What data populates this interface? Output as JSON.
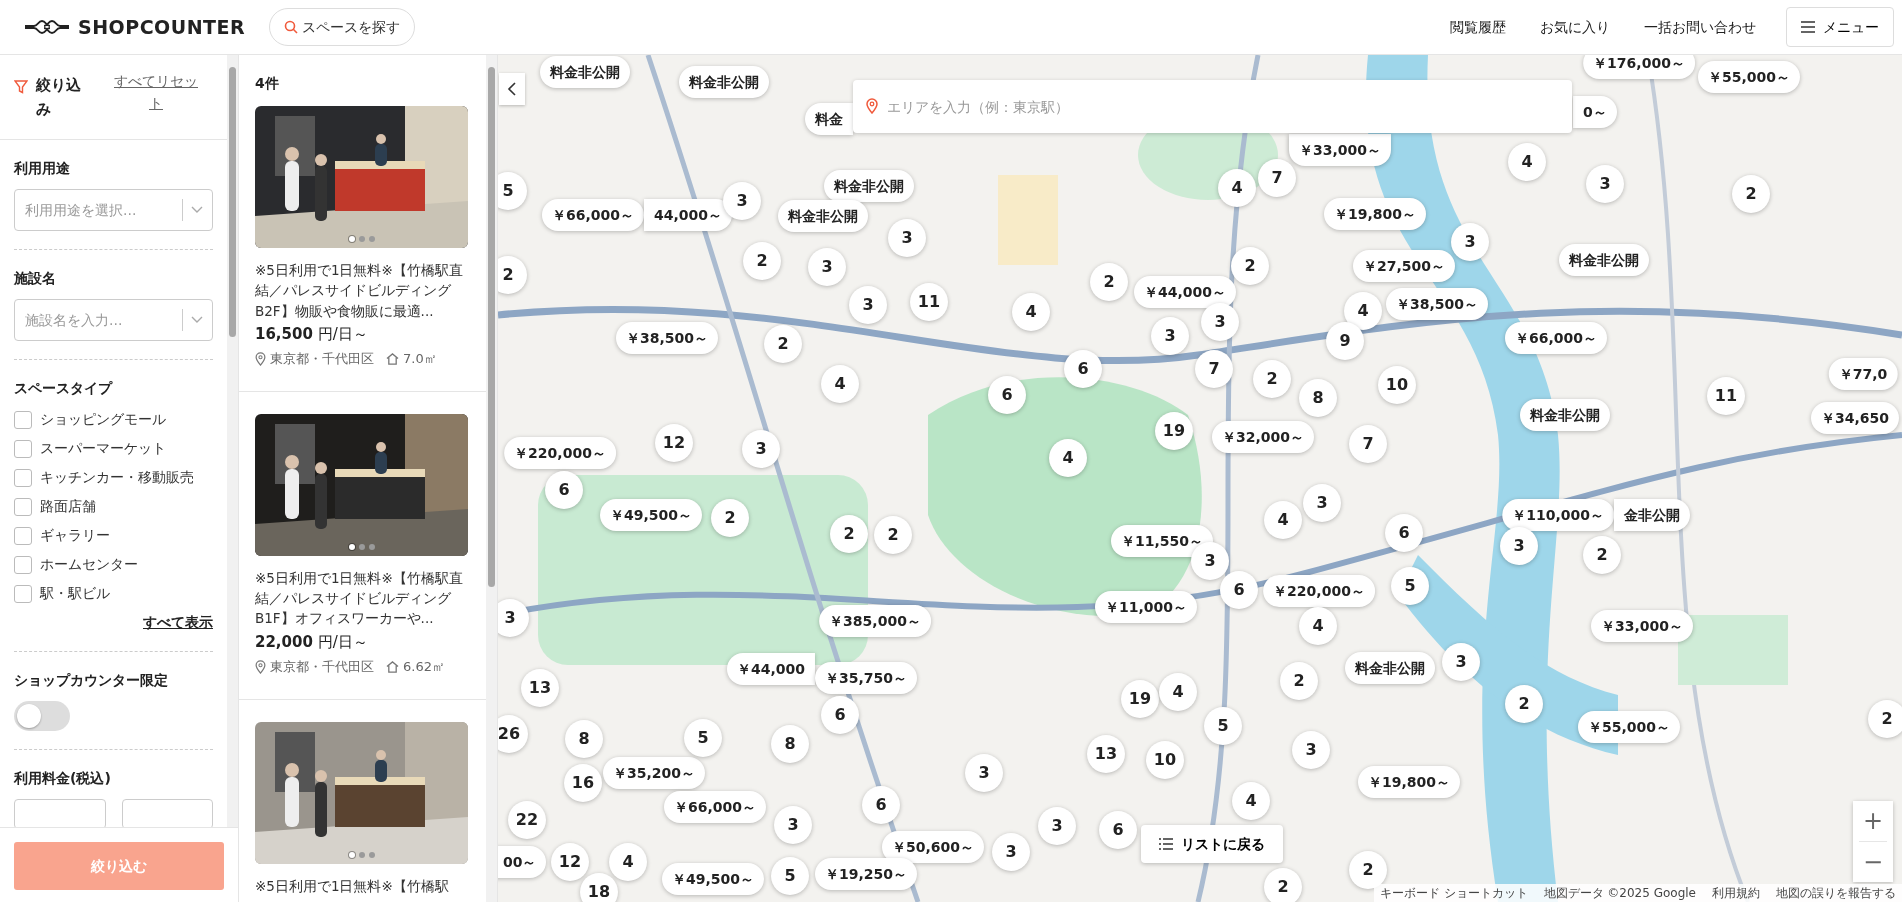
{
  "header": {
    "logo": "SHOPCOUNTER",
    "search_button": "スペースを探す",
    "nav": [
      "閲覧履歴",
      "お気に入り",
      "一括お問い合わせ"
    ],
    "menu_button": "メニュー"
  },
  "filters": {
    "title": "絞り込み",
    "reset": "すべてリセット",
    "apply_button": "絞り込む",
    "sections": [
      {
        "kind": "select",
        "label": "利用用途",
        "placeholder": "利用用途を選択..."
      },
      {
        "kind": "select",
        "label": "施設名",
        "placeholder": "施設名を入力..."
      },
      {
        "kind": "checklist",
        "label": "スペースタイプ",
        "more": "すべて表示",
        "options": [
          {
            "label": "ショッピングモール",
            "checked": false
          },
          {
            "label": "スーパーマーケット",
            "checked": false
          },
          {
            "label": "キッチンカー・移動販売",
            "checked": false
          },
          {
            "label": "路面店舗",
            "checked": false
          },
          {
            "label": "ギャラリー",
            "checked": false
          },
          {
            "label": "ホームセンター",
            "checked": false
          },
          {
            "label": "駅・駅ビル",
            "checked": false
          }
        ]
      },
      {
        "kind": "toggle",
        "label": "ショップカウンター限定",
        "on": false
      },
      {
        "kind": "range",
        "label": "利用料金(税込)"
      }
    ]
  },
  "listing": {
    "count": "4件",
    "cards": [
      {
        "title": "※5日利用で1日無料※【竹橋駅直結／パレスサイドビルディングB2F】物販や食物販に最適...",
        "price": "**16,500** 円/日～",
        "location": "東京都・千代田区",
        "area": "7.0㎡",
        "slides": [
          {
            "selected": true
          },
          {
            "selected": false
          },
          {
            "selected": false
          }
        ]
      },
      {
        "title": "※5日利用で1日無料※【竹橋駅直結／パレスサイドビルディングB1F】オフィスワーカーや...",
        "price": "**22,000** 円/日～",
        "location": "東京都・千代田区",
        "area": "6.62㎡",
        "slides": [
          {
            "selected": true
          },
          {
            "selected": false
          },
          {
            "selected": false
          }
        ]
      },
      {
        "title": "※5日利用で1日無料※【竹橋駅",
        "slides": [
          {
            "selected": true
          },
          {
            "selected": false
          },
          {
            "selected": false
          }
        ]
      }
    ]
  },
  "map": {
    "search_placeholder": "エリアを入力（例：東京駅）",
    "back_to_list": "リストに戻る",
    "zoom_in": "+",
    "zoom_out": "−",
    "attribution": [
      "キーボード ショートカット",
      "地図データ ©2025 Google",
      "利用規約",
      "地図の誤りを報告する"
    ],
    "markers": [
      {
        "kind": "price",
        "text": "料金非公開"
      },
      {
        "kind": "price",
        "text": "料金非公開"
      },
      {
        "kind": "price",
        "text": "￥176,000～"
      },
      {
        "kind": "price",
        "text": "￥55,000～"
      },
      {
        "kind": "price",
        "text": "料金"
      },
      {
        "kind": "price",
        "text": "0～"
      },
      {
        "kind": "price",
        "text": "￥33,000～"
      },
      {
        "kind": "count",
        "text": "5"
      },
      {
        "kind": "price",
        "text": "料金非公開"
      },
      {
        "kind": "count",
        "text": "4"
      },
      {
        "kind": "count",
        "text": "7"
      },
      {
        "kind": "count",
        "text": "4"
      },
      {
        "kind": "count",
        "text": "3"
      },
      {
        "kind": "price",
        "text": "￥66,000～"
      },
      {
        "kind": "price",
        "text": "44,000～"
      },
      {
        "kind": "count",
        "text": "3"
      },
      {
        "kind": "price",
        "text": "料金非公開"
      },
      {
        "kind": "count",
        "text": "3"
      },
      {
        "kind": "price",
        "text": "￥19,800～"
      },
      {
        "kind": "count",
        "text": "3"
      },
      {
        "kind": "count",
        "text": "2"
      },
      {
        "kind": "count",
        "text": "2"
      },
      {
        "kind": "count",
        "text": "2"
      },
      {
        "kind": "count",
        "text": "3"
      },
      {
        "kind": "count",
        "text": "2"
      },
      {
        "kind": "count",
        "text": "2"
      },
      {
        "kind": "price",
        "text": "￥27,500～"
      },
      {
        "kind": "price",
        "text": "料金非公開"
      },
      {
        "kind": "price",
        "text": "￥38,500～"
      },
      {
        "kind": "count",
        "text": "2"
      },
      {
        "kind": "count",
        "text": "3"
      },
      {
        "kind": "count",
        "text": "11"
      },
      {
        "kind": "count",
        "text": "4"
      },
      {
        "kind": "price",
        "text": "￥44,000～"
      },
      {
        "kind": "count",
        "text": "3"
      },
      {
        "kind": "count",
        "text": "3"
      },
      {
        "kind": "count",
        "text": "4"
      },
      {
        "kind": "price",
        "text": "￥38,500～"
      },
      {
        "kind": "price",
        "text": "￥66,000～"
      },
      {
        "kind": "count",
        "text": "4"
      },
      {
        "kind": "count",
        "text": "6"
      },
      {
        "kind": "count",
        "text": "7"
      },
      {
        "kind": "count",
        "text": "2"
      },
      {
        "kind": "count",
        "text": "9"
      },
      {
        "kind": "count",
        "text": "10"
      },
      {
        "kind": "price",
        "text": "￥77,0"
      },
      {
        "kind": "count",
        "text": "6"
      },
      {
        "kind": "count",
        "text": "19"
      },
      {
        "kind": "count",
        "text": "8"
      },
      {
        "kind": "price",
        "text": "料金非公開"
      },
      {
        "kind": "count",
        "text": "11"
      },
      {
        "kind": "price",
        "text": "￥34,650"
      },
      {
        "kind": "price",
        "text": "￥220,000～"
      },
      {
        "kind": "count",
        "text": "12"
      },
      {
        "kind": "count",
        "text": "3"
      },
      {
        "kind": "count",
        "text": "4"
      },
      {
        "kind": "price",
        "text": "￥32,000～"
      },
      {
        "kind": "count",
        "text": "7"
      },
      {
        "kind": "count",
        "text": "6"
      },
      {
        "kind": "price",
        "text": "￥49,500～"
      },
      {
        "kind": "count",
        "text": "2"
      },
      {
        "kind": "count",
        "text": "4"
      },
      {
        "kind": "count",
        "text": "3"
      },
      {
        "kind": "count",
        "text": "6"
      },
      {
        "kind": "price",
        "text": "￥110,000～"
      },
      {
        "kind": "price",
        "text": "金非公開"
      },
      {
        "kind": "count",
        "text": "2"
      },
      {
        "kind": "count",
        "text": "2"
      },
      {
        "kind": "price",
        "text": "￥11,550～"
      },
      {
        "kind": "count",
        "text": "3"
      },
      {
        "kind": "count",
        "text": "3"
      },
      {
        "kind": "count",
        "text": "2"
      },
      {
        "kind": "count",
        "text": "3"
      },
      {
        "kind": "price",
        "text": "￥385,000～"
      },
      {
        "kind": "price",
        "text": "￥11,000～"
      },
      {
        "kind": "count",
        "text": "6"
      },
      {
        "kind": "price",
        "text": "￥220,000～"
      },
      {
        "kind": "count",
        "text": "4"
      },
      {
        "kind": "count",
        "text": "5"
      },
      {
        "kind": "price",
        "text": "￥33,000～"
      },
      {
        "kind": "price",
        "text": "￥44,000"
      },
      {
        "kind": "price",
        "text": "料金非公開"
      },
      {
        "kind": "count",
        "text": "3"
      },
      {
        "kind": "count",
        "text": "13"
      },
      {
        "kind": "price",
        "text": "￥35,750～"
      },
      {
        "kind": "count",
        "text": "6"
      },
      {
        "kind": "count",
        "text": "19"
      },
      {
        "kind": "count",
        "text": "4"
      },
      {
        "kind": "count",
        "text": "5"
      },
      {
        "kind": "count",
        "text": "2"
      },
      {
        "kind": "count",
        "text": "2"
      },
      {
        "kind": "price",
        "text": "￥55,000～"
      },
      {
        "kind": "count",
        "text": "2"
      },
      {
        "kind": "count",
        "text": "26"
      },
      {
        "kind": "count",
        "text": "8"
      },
      {
        "kind": "price",
        "text": "￥35,200～"
      },
      {
        "kind": "count",
        "text": "5"
      },
      {
        "kind": "count",
        "text": "8"
      },
      {
        "kind": "count",
        "text": "3"
      },
      {
        "kind": "count",
        "text": "13"
      },
      {
        "kind": "count",
        "text": "10"
      },
      {
        "kind": "count",
        "text": "3"
      },
      {
        "kind": "count",
        "text": "22"
      },
      {
        "kind": "count",
        "text": "16"
      },
      {
        "kind": "price",
        "text": "￥66,000～"
      },
      {
        "kind": "count",
        "text": "6"
      },
      {
        "kind": "count",
        "text": "4"
      },
      {
        "kind": "price",
        "text": "￥19,800～"
      },
      {
        "kind": "price",
        "text": "00～"
      },
      {
        "kind": "count",
        "text": "12"
      },
      {
        "kind": "count",
        "text": "4"
      },
      {
        "kind": "count",
        "text": "3"
      },
      {
        "kind": "price",
        "text": "￥50,600～"
      },
      {
        "kind": "count",
        "text": "3"
      },
      {
        "kind": "count",
        "text": "3"
      },
      {
        "kind": "count",
        "text": "6"
      },
      {
        "kind": "count",
        "text": "2"
      },
      {
        "kind": "count",
        "text": "18"
      },
      {
        "kind": "price",
        "text": "￥49,500～"
      },
      {
        "kind": "count",
        "text": "5"
      },
      {
        "kind": "price",
        "text": "￥19,250～"
      },
      {
        "kind": "count",
        "text": "2"
      }
    ]
  }
}
